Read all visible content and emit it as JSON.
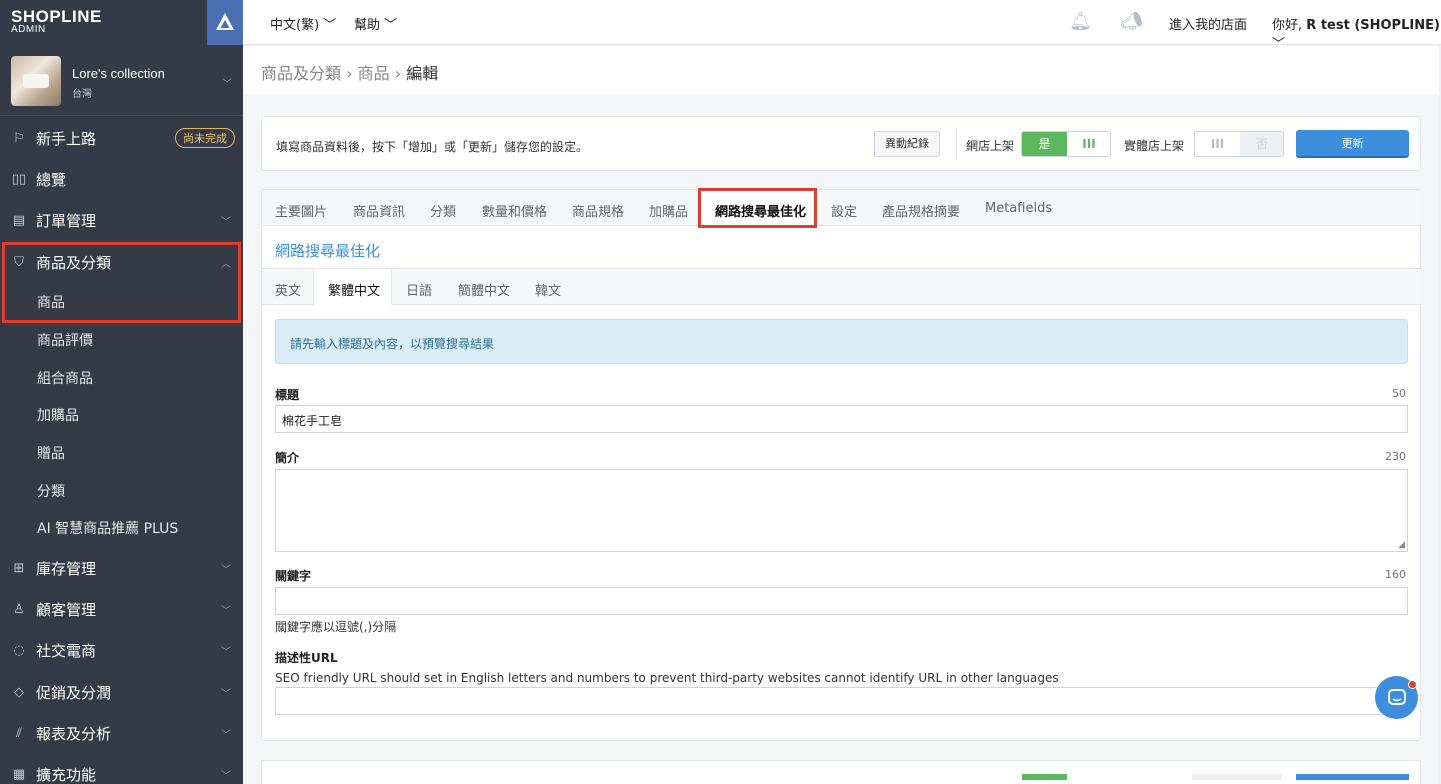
{
  "brand": {
    "logo": "SHOPLINE",
    "sub": "ADMIN"
  },
  "store": {
    "name": "Lore's collection",
    "region": "台灣"
  },
  "sidebar": {
    "items": [
      {
        "label": "新手上路",
        "icon": "signpost-icon",
        "badge": "尚未完成"
      },
      {
        "label": "總覽",
        "icon": "dashboard-icon"
      },
      {
        "label": "訂單管理",
        "icon": "clipboard-icon"
      },
      {
        "label": "商品及分類",
        "icon": "shopping-bag-icon"
      },
      {
        "label": "庫存管理",
        "icon": "inventory-icon"
      },
      {
        "label": "顧客管理",
        "icon": "user-icon"
      },
      {
        "label": "社交電商",
        "icon": "chat-icon"
      },
      {
        "label": "促銷及分潤",
        "icon": "tag-icon"
      },
      {
        "label": "報表及分析",
        "icon": "chart-icon"
      },
      {
        "label": "擴充功能",
        "icon": "grid-icon"
      }
    ],
    "subitems": [
      "商品",
      "商品評價",
      "組合商品",
      "加購品",
      "贈品",
      "分類",
      "AI 智慧商品推薦 PLUS"
    ]
  },
  "topbar": {
    "language": "中文(繁)",
    "help": "幫助",
    "visit_store": "進入我的店面",
    "greeting_prefix": "你好,",
    "user": "R test (SHOPLINE)"
  },
  "breadcrumb": {
    "level1": "商品及分類",
    "level2": "商品",
    "current": "編輯"
  },
  "actionbar": {
    "hint": "填寫商品資料後，按下「增加」或「更新」儲存您的設定。",
    "log_button": "異動紀錄",
    "online_label": "網店上架",
    "online_on": "是",
    "online_bars": "III",
    "retail_label": "實體店上架",
    "retail_bars": "III",
    "retail_off": "否",
    "update_button": "更新"
  },
  "tabs": [
    "主要圖片",
    "商品資訊",
    "分類",
    "數量和價格",
    "商品規格",
    "加購品",
    "網路搜尋最佳化",
    "設定",
    "產品規格摘要",
    "Metafields"
  ],
  "section_title": "網路搜尋最佳化",
  "lang_tabs": [
    "英文",
    "繁體中文",
    "日語",
    "簡體中文",
    "韓文"
  ],
  "info_text": "請先輸入標題及內容，以預覽搜尋結果",
  "fields": {
    "title": {
      "label": "標題",
      "count": "50",
      "value": "棉花手工皂"
    },
    "intro": {
      "label": "簡介",
      "count": "230",
      "value": ""
    },
    "keywords": {
      "label": "關鍵字",
      "count": "160",
      "value": "",
      "help": "關鍵字應以逗號(,)分隔"
    },
    "url": {
      "label": "描述性URL",
      "help": "SEO friendly URL should set in English letters and numbers to prevent third-party websites cannot identify URL in other languages",
      "value": ""
    }
  },
  "colors": {
    "sidebar": "#343a46",
    "accent": "#3d8fde",
    "success": "#5cb85c",
    "highlight": "#e33c2e"
  }
}
